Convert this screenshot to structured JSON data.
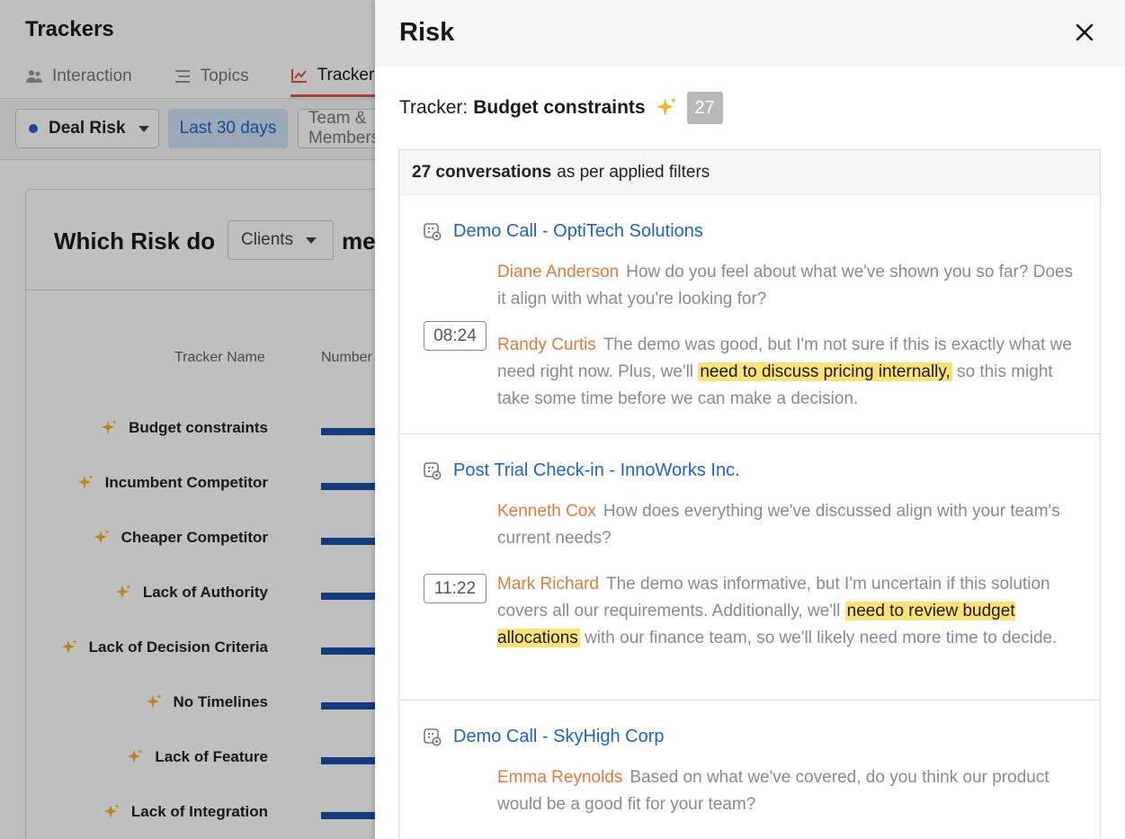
{
  "background": {
    "page_title": "Trackers",
    "tabs": [
      {
        "label": "Interaction",
        "icon": "people-icon"
      },
      {
        "label": "Topics",
        "icon": "list-icon"
      },
      {
        "label": "Trackers",
        "icon": "tracker-icon",
        "active": true
      }
    ],
    "filters": {
      "deal_risk": "Deal Risk",
      "date_range": "Last 30 days",
      "team": "Team & Members"
    },
    "question_prefix": "Which Risk do",
    "clients_dropdown": "Clients",
    "question_suffix": "mention",
    "columns": {
      "tracker_name": "Tracker Name",
      "number": "Number of conversations"
    },
    "trackers": [
      "Budget constraints",
      "Incumbent Competitor",
      "Cheaper Competitor",
      "Lack of Authority",
      "Lack of Decision Criteria",
      "No Timelines",
      "Lack of Feature",
      "Lack of Integration"
    ]
  },
  "drawer": {
    "title": "Risk",
    "tracker_label": "Tracker:",
    "tracker_value": "Budget constraints",
    "count": "27",
    "summary_bold": "27 conversations",
    "summary_rest": "as per applied filters",
    "conversations": [
      {
        "title": "Demo Call - OptiTech Solutions",
        "timestamp": "08:24",
        "utterances": [
          {
            "speaker": "Diane Anderson",
            "pre": "How do you feel about what we've shown you so far? Does it align with what you're looking for?",
            "highlight": "",
            "post": ""
          },
          {
            "speaker": "Randy Curtis",
            "pre": "The demo was good, but I'm not sure if this is exactly what we need right now. Plus, we'll",
            "highlight": "need to discuss pricing internally,",
            "post": "so this might take some time before we can make a decision."
          }
        ]
      },
      {
        "title": "Post Trial Check-in - InnoWorks Inc.",
        "timestamp": "11:22",
        "utterances": [
          {
            "speaker": "Kenneth Cox",
            "pre": "How does everything we've discussed align with your team's current needs?",
            "highlight": "",
            "post": ""
          },
          {
            "speaker": "Mark Richard",
            "pre": "The demo was informative, but I'm uncertain if this solution covers all our requirements. Additionally, we'll",
            "highlight": "need to review budget allocations",
            "post": "with our finance team, so we'll likely need more time to decide."
          }
        ]
      },
      {
        "title": "Demo Call - SkyHigh Corp",
        "utterances": [
          {
            "speaker": "Emma Reynolds",
            "pre": "Based on what we've covered, do you think our product would be a good fit for your team?",
            "highlight": "",
            "post": ""
          }
        ]
      }
    ]
  },
  "colors": {
    "accent_link": "#1f63c8",
    "speaker": "#e07a3f",
    "highlight": "#fde27a",
    "bar": "#1d4fa8",
    "tab_active": "#d9534f"
  }
}
